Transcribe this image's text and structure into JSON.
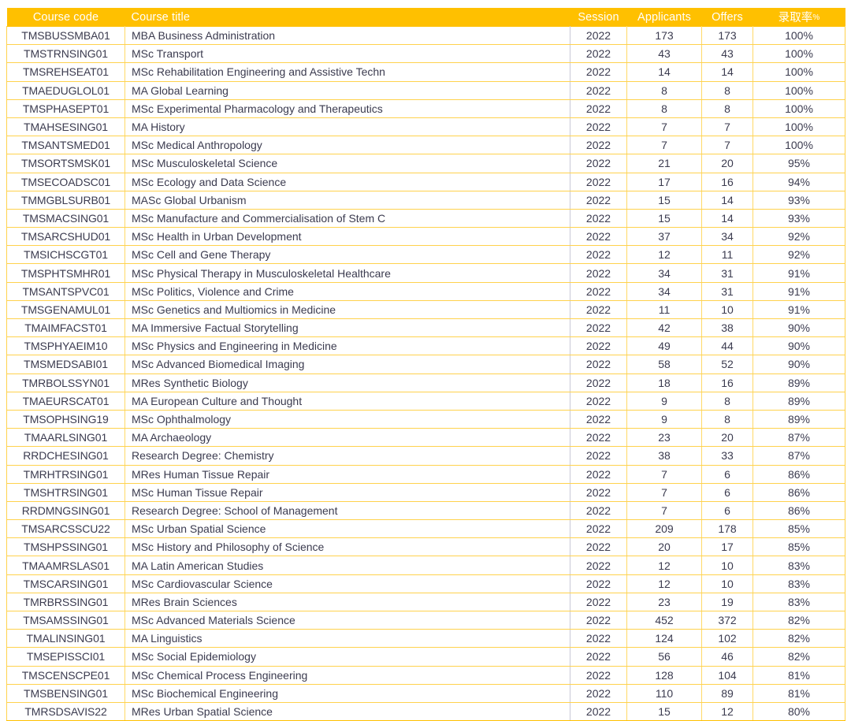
{
  "table": {
    "columns": [
      {
        "key": "code",
        "label": "Course code"
      },
      {
        "key": "title",
        "label": "Course title"
      },
      {
        "key": "session",
        "label": "Session"
      },
      {
        "key": "apps",
        "label": "Applicants"
      },
      {
        "key": "offers",
        "label": "Offers"
      },
      {
        "key": "rate",
        "label": "录取率",
        "suffix": "%"
      }
    ],
    "header_bg": "#FFC000",
    "header_text_color": "#FFFFFF",
    "grid_color": "#FFD24D",
    "body_text_color": "#3B3B4F",
    "rows": [
      {
        "code": "TMSBUSSMBA01",
        "title": "MBA Business Administration",
        "session": "2022",
        "apps": "173",
        "offers": "173",
        "rate": "100%"
      },
      {
        "code": "TMSTRNSING01",
        "title": "MSc Transport",
        "session": "2022",
        "apps": "43",
        "offers": "43",
        "rate": "100%"
      },
      {
        "code": "TMSREHSEAT01",
        "title": "MSc Rehabilitation Engineering and Assistive Techn",
        "session": "2022",
        "apps": "14",
        "offers": "14",
        "rate": "100%"
      },
      {
        "code": "TMAEDUGLOL01",
        "title": "MA Global Learning",
        "session": "2022",
        "apps": "8",
        "offers": "8",
        "rate": "100%"
      },
      {
        "code": "TMSPHASEPT01",
        "title": "MSc Experimental Pharmacology and Therapeutics",
        "session": "2022",
        "apps": "8",
        "offers": "8",
        "rate": "100%"
      },
      {
        "code": "TMAHSESING01",
        "title": "MA History",
        "session": "2022",
        "apps": "7",
        "offers": "7",
        "rate": "100%"
      },
      {
        "code": "TMSANTSMED01",
        "title": "MSc Medical Anthropology",
        "session": "2022",
        "apps": "7",
        "offers": "7",
        "rate": "100%"
      },
      {
        "code": "TMSORTSMSK01",
        "title": "MSc Musculoskeletal Science",
        "session": "2022",
        "apps": "21",
        "offers": "20",
        "rate": "95%"
      },
      {
        "code": "TMSECOADSC01",
        "title": "MSc Ecology and Data Science",
        "session": "2022",
        "apps": "17",
        "offers": "16",
        "rate": "94%"
      },
      {
        "code": "TMMGBLSURB01",
        "title": "MASc Global Urbanism",
        "session": "2022",
        "apps": "15",
        "offers": "14",
        "rate": "93%"
      },
      {
        "code": "TMSMACSING01",
        "title": "MSc Manufacture and Commercialisation of Stem C",
        "session": "2022",
        "apps": "15",
        "offers": "14",
        "rate": "93%"
      },
      {
        "code": "TMSARCSHUD01",
        "title": "MSc Health in Urban Development",
        "session": "2022",
        "apps": "37",
        "offers": "34",
        "rate": "92%"
      },
      {
        "code": "TMSICHSCGT01",
        "title": "MSc Cell and Gene Therapy",
        "session": "2022",
        "apps": "12",
        "offers": "11",
        "rate": "92%"
      },
      {
        "code": "TMSPHTSMHR01",
        "title": "MSc Physical Therapy in Musculoskeletal Healthcare",
        "session": "2022",
        "apps": "34",
        "offers": "31",
        "rate": "91%"
      },
      {
        "code": "TMSANTSPVC01",
        "title": "MSc Politics, Violence and Crime",
        "session": "2022",
        "apps": "34",
        "offers": "31",
        "rate": "91%"
      },
      {
        "code": "TMSGENAMUL01",
        "title": "MSc Genetics and Multiomics in Medicine",
        "session": "2022",
        "apps": "11",
        "offers": "10",
        "rate": "91%"
      },
      {
        "code": "TMAIMFACST01",
        "title": "MA Immersive Factual Storytelling",
        "session": "2022",
        "apps": "42",
        "offers": "38",
        "rate": "90%"
      },
      {
        "code": "TMSPHYAEIM10",
        "title": "MSc Physics and Engineering in Medicine",
        "session": "2022",
        "apps": "49",
        "offers": "44",
        "rate": "90%"
      },
      {
        "code": "TMSMEDSABI01",
        "title": "MSc Advanced Biomedical Imaging",
        "session": "2022",
        "apps": "58",
        "offers": "52",
        "rate": "90%"
      },
      {
        "code": "TMRBOLSSYN01",
        "title": "MRes Synthetic Biology",
        "session": "2022",
        "apps": "18",
        "offers": "16",
        "rate": "89%"
      },
      {
        "code": "TMAEURSCAT01",
        "title": "MA European Culture and Thought",
        "session": "2022",
        "apps": "9",
        "offers": "8",
        "rate": "89%"
      },
      {
        "code": "TMSOPHSING19",
        "title": "MSc Ophthalmology",
        "session": "2022",
        "apps": "9",
        "offers": "8",
        "rate": "89%"
      },
      {
        "code": "TMAARLSING01",
        "title": "MA Archaeology",
        "session": "2022",
        "apps": "23",
        "offers": "20",
        "rate": "87%"
      },
      {
        "code": "RRDCHESING01",
        "title": "Research Degree:  Chemistry",
        "session": "2022",
        "apps": "38",
        "offers": "33",
        "rate": "87%"
      },
      {
        "code": "TMRHTRSING01",
        "title": "MRes Human Tissue Repair",
        "session": "2022",
        "apps": "7",
        "offers": "6",
        "rate": "86%"
      },
      {
        "code": "TMSHTRSING01",
        "title": "MSc Human Tissue Repair",
        "session": "2022",
        "apps": "7",
        "offers": "6",
        "rate": "86%"
      },
      {
        "code": "RRDMNGSING01",
        "title": "Research Degree: School of Management",
        "session": "2022",
        "apps": "7",
        "offers": "6",
        "rate": "86%"
      },
      {
        "code": "TMSARCSSCU22",
        "title": "MSc Urban Spatial Science",
        "session": "2022",
        "apps": "209",
        "offers": "178",
        "rate": "85%"
      },
      {
        "code": "TMSHPSSING01",
        "title": "MSc History and Philosophy of Science",
        "session": "2022",
        "apps": "20",
        "offers": "17",
        "rate": "85%"
      },
      {
        "code": "TMAAMRSLAS01",
        "title": "MA Latin American Studies",
        "session": "2022",
        "apps": "12",
        "offers": "10",
        "rate": "83%"
      },
      {
        "code": "TMSCARSING01",
        "title": "MSc Cardiovascular Science",
        "session": "2022",
        "apps": "12",
        "offers": "10",
        "rate": "83%"
      },
      {
        "code": "TMRBRSSING01",
        "title": "MRes Brain Sciences",
        "session": "2022",
        "apps": "23",
        "offers": "19",
        "rate": "83%"
      },
      {
        "code": "TMSAMSSING01",
        "title": "MSc Advanced Materials Science",
        "session": "2022",
        "apps": "452",
        "offers": "372",
        "rate": "82%"
      },
      {
        "code": "TMALINSING01",
        "title": "MA Linguistics",
        "session": "2022",
        "apps": "124",
        "offers": "102",
        "rate": "82%"
      },
      {
        "code": "TMSEPISSCI01",
        "title": "MSc Social Epidemiology",
        "session": "2022",
        "apps": "56",
        "offers": "46",
        "rate": "82%"
      },
      {
        "code": "TMSCENSCPE01",
        "title": "MSc Chemical Process Engineering",
        "session": "2022",
        "apps": "128",
        "offers": "104",
        "rate": "81%"
      },
      {
        "code": "TMSBENSING01",
        "title": "MSc Biochemical Engineering",
        "session": "2022",
        "apps": "110",
        "offers": "89",
        "rate": "81%"
      },
      {
        "code": "TMRSDSAVIS22",
        "title": "MRes Urban Spatial Science",
        "session": "2022",
        "apps": "15",
        "offers": "12",
        "rate": "80%"
      }
    ]
  }
}
